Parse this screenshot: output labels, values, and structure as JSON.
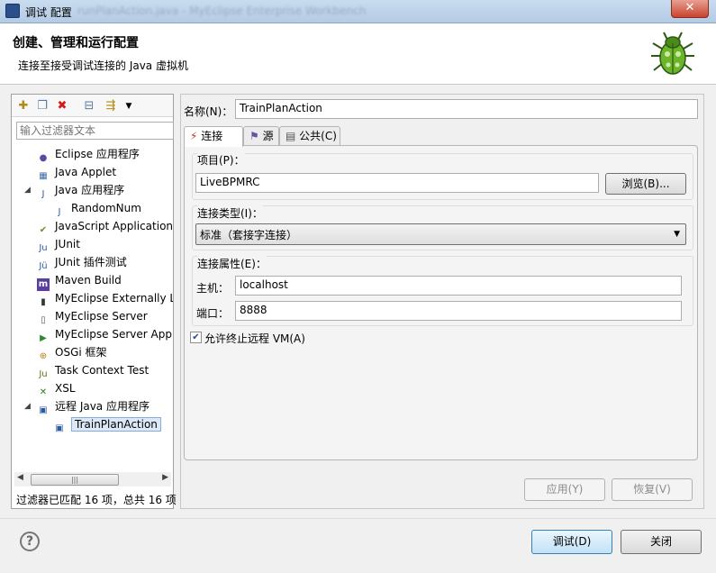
{
  "window": {
    "title": "调试 配置",
    "title_blurred": "runPlanAction.java - MyEclipse Enterprise Workbench"
  },
  "header": {
    "title": "创建、管理和运行配置",
    "subtitle": "连接至接受调试连接的 Java 虚拟机"
  },
  "left": {
    "filter_placeholder": "输入过滤器文本",
    "items": [
      {
        "label": "Eclipse 应用程序",
        "icon": "eclipse-icon",
        "level": 0,
        "expander": ""
      },
      {
        "label": "Java Applet",
        "icon": "applet-icon",
        "level": 0,
        "expander": ""
      },
      {
        "label": "Java 应用程序",
        "icon": "java-app-icon",
        "level": 0,
        "expander": "◢"
      },
      {
        "label": "RandomNum",
        "icon": "java-file-icon",
        "level": 1,
        "expander": ""
      },
      {
        "label": "JavaScript Application",
        "icon": "javascript-icon",
        "level": 0,
        "expander": ""
      },
      {
        "label": "JUnit",
        "icon": "junit-icon",
        "level": 0,
        "expander": ""
      },
      {
        "label": "JUnit 插件测试",
        "icon": "junit-plugin-icon",
        "level": 0,
        "expander": ""
      },
      {
        "label": "Maven Build",
        "icon": "maven-icon",
        "level": 0,
        "expander": ""
      },
      {
        "label": "MyEclipse Externally La",
        "icon": "external-launch-icon",
        "level": 0,
        "expander": ""
      },
      {
        "label": "MyEclipse Server",
        "icon": "server-icon",
        "level": 0,
        "expander": ""
      },
      {
        "label": "MyEclipse Server Appl",
        "icon": "server-app-icon",
        "level": 0,
        "expander": ""
      },
      {
        "label": "OSGi 框架",
        "icon": "osgi-icon",
        "level": 0,
        "expander": ""
      },
      {
        "label": "Task Context Test",
        "icon": "task-test-icon",
        "level": 0,
        "expander": ""
      },
      {
        "label": "XSL",
        "icon": "xsl-icon",
        "level": 0,
        "expander": ""
      },
      {
        "label": "远程 Java 应用程序",
        "icon": "remote-java-icon",
        "level": 0,
        "expander": "◢"
      },
      {
        "label": "TrainPlanAction",
        "icon": "remote-config-icon",
        "level": 1,
        "expander": "",
        "selected": true
      }
    ],
    "status": "过滤器已匹配 16 项，总共 16 项"
  },
  "right": {
    "name_label": "名称(N)：",
    "name_value": "TrainPlanAction",
    "tabs": [
      {
        "label": "连接",
        "icon": "connect-icon",
        "active": true
      },
      {
        "label": "源",
        "icon": "source-icon",
        "active": false
      },
      {
        "label": "公共(C)",
        "icon": "common-icon",
        "active": false
      }
    ],
    "project_label": "项目(P)：",
    "project_value": "LiveBPMRC",
    "browse_button": "浏览(B)...",
    "conn_type_label": "连接类型(I)：",
    "conn_type_value": "标准（套接字连接）",
    "conn_props_label": "连接属性(E)：",
    "host_label": "主机：",
    "host_value": "localhost",
    "port_label": "端口：",
    "port_value": "8888",
    "allow_terminate_label": "允许终止远程 VM(A)",
    "allow_terminate_checked": true,
    "apply_button": "应用(Y)",
    "revert_button": "恢复(V)"
  },
  "footer": {
    "debug_button": "调试(D)",
    "close_button": "关闭"
  }
}
